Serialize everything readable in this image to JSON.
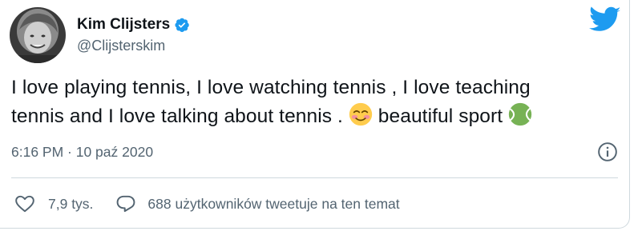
{
  "author": {
    "display_name": "Kim Clijsters",
    "handle": "@Clijsterskim",
    "verified": true
  },
  "tweet": {
    "line1": "I love playing tennis, I love watching tennis , I love teaching",
    "line2_a": "tennis and I love talking about tennis . ",
    "line2_b": " beautiful sport ",
    "emojis": [
      "smiling-face-with-blush-emoji",
      "tennis-ball-emoji"
    ]
  },
  "meta": {
    "timestamp": "6:16 PM · 10 paź 2020"
  },
  "actions": {
    "like_count": "7,9 tys.",
    "reply_text": "688 użytkowników tweetuje na ten temat"
  },
  "colors": {
    "brand_blue": "#1d9bf0",
    "text": "#0f1419",
    "secondary": "#536471",
    "border": "#cfd9de"
  },
  "icons": [
    "twitter-bird-icon",
    "verified-badge-icon",
    "info-icon",
    "heart-icon",
    "comment-icon"
  ]
}
